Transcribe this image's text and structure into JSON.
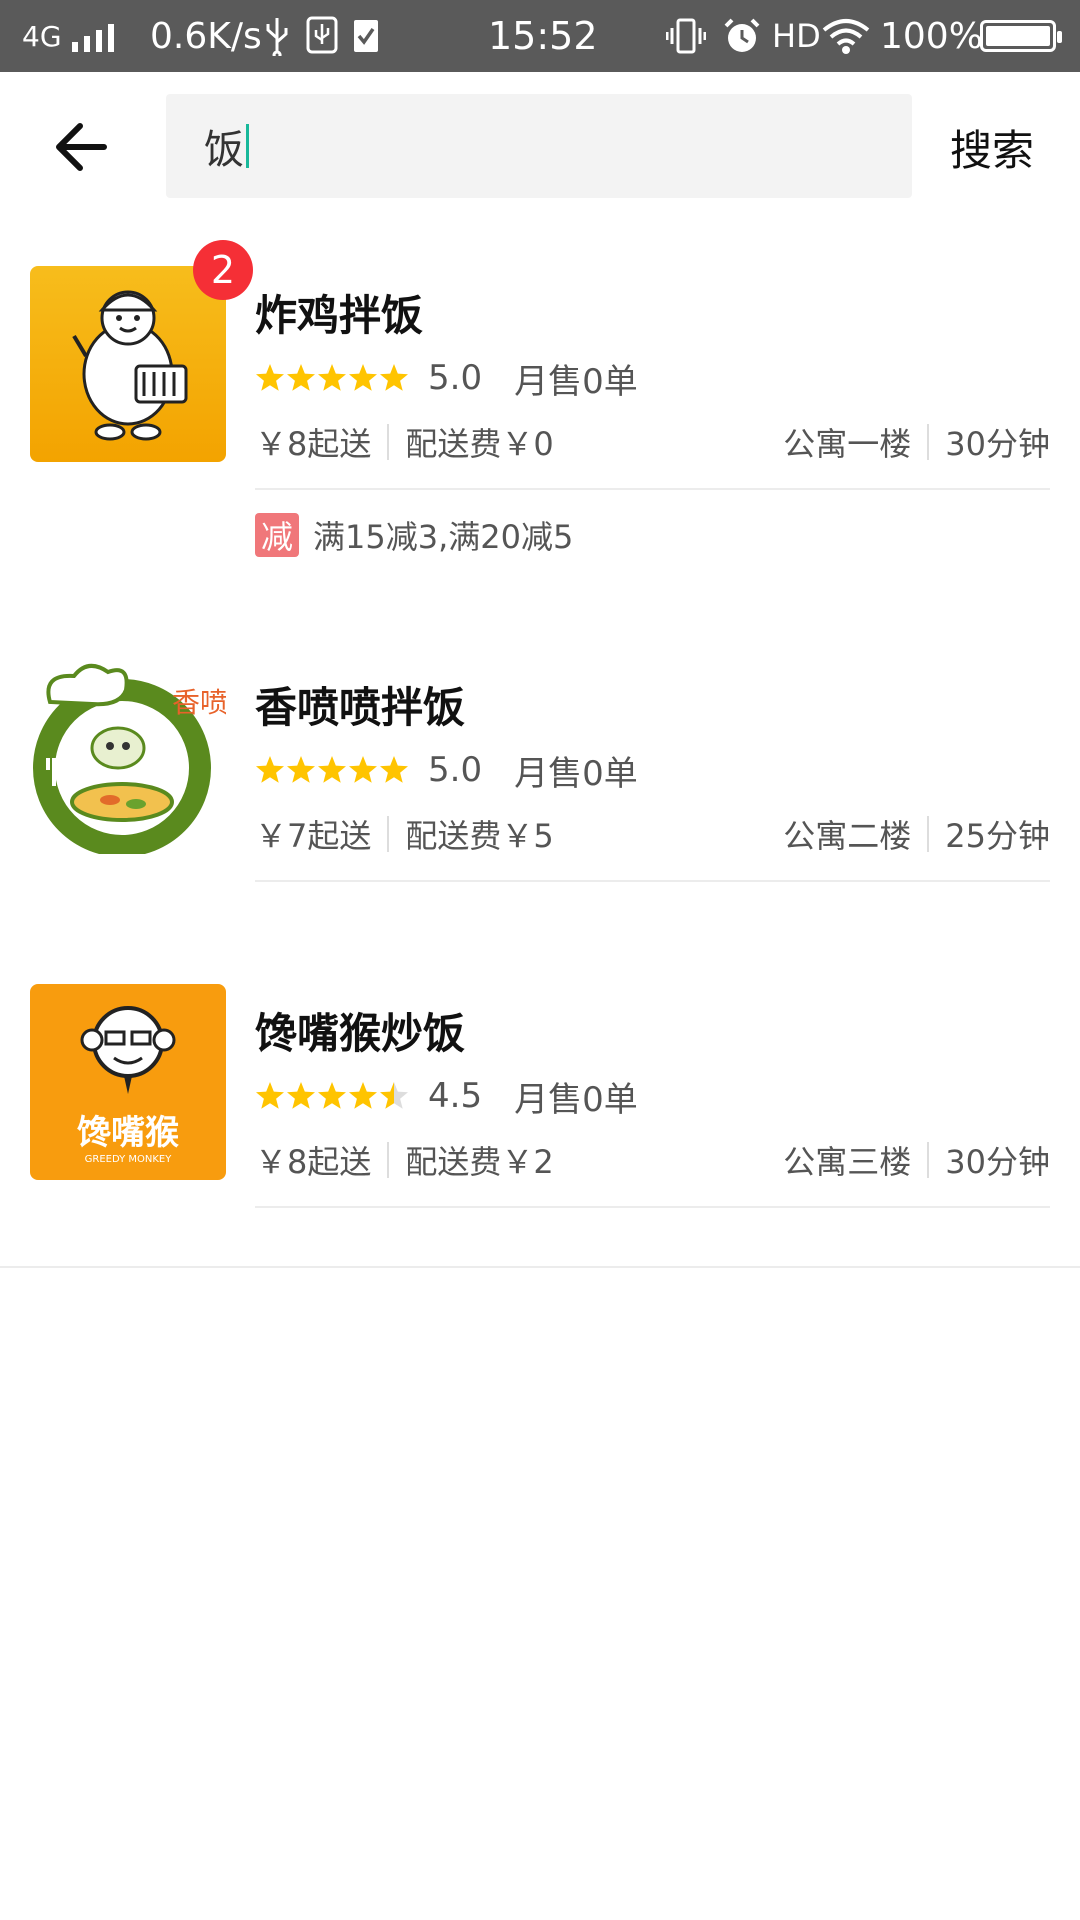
{
  "status_bar": {
    "network": "4G",
    "speed": "0.6K/s",
    "time": "15:52",
    "hd": "HD",
    "battery": "100%",
    "battery_level": 1.0
  },
  "search": {
    "query": "饭",
    "button_label": "搜索"
  },
  "shops": [
    {
      "name": "炸鸡拌饭",
      "badge": "2",
      "rating": "5.0",
      "rating_value": 5.0,
      "sales": "月售0单",
      "min_order": "￥8起送",
      "delivery_fee": "配送费￥0",
      "location": "公寓一楼",
      "delivery_time": "30分钟",
      "promo_tag": "减",
      "promo_text": "满15减3,满20减5"
    },
    {
      "name": "香喷喷拌饭",
      "rating": "5.0",
      "rating_value": 5.0,
      "sales": "月售0单",
      "min_order": "￥7起送",
      "delivery_fee": "配送费￥5",
      "location": "公寓二楼",
      "delivery_time": "25分钟",
      "logo_text": "香喷喷"
    },
    {
      "name": "馋嘴猴炒饭",
      "rating": "4.5",
      "rating_value": 4.5,
      "sales": "月售0单",
      "min_order": "￥8起送",
      "delivery_fee": "配送费￥2",
      "location": "公寓三楼",
      "delivery_time": "30分钟",
      "logo_text": "馋嘴猴",
      "logo_subtext": "GREEDY MONKEY"
    }
  ],
  "colors": {
    "status_bar": "#5a5a5a",
    "star": "#ffc400",
    "star_empty": "#dddddd",
    "badge": "#f52f36",
    "promo_tag": "#f0777a",
    "caret": "#18b89a"
  }
}
